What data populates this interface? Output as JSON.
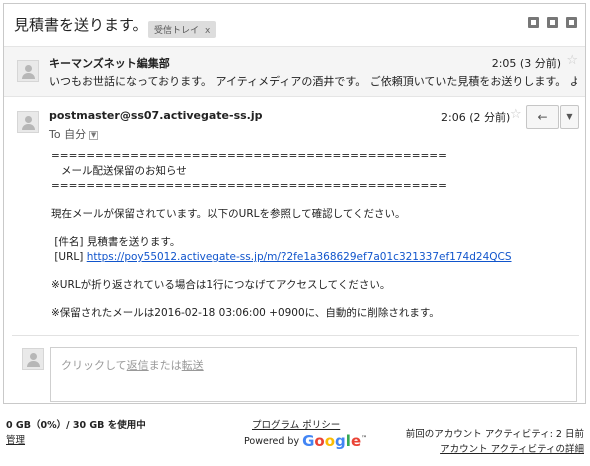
{
  "thread": {
    "subject": "見積書を送ります。",
    "label": "受信トレイ",
    "label_close": "x"
  },
  "messages": [
    {
      "sender": "キーマンズネット編集部",
      "time": "2:05 (3 分前)",
      "snippet": "いつもお世話になっております。 アイティメディアの酒井です。 ご依頼頂いていた見積をお送りします。 よ"
    },
    {
      "sender": "postmaster@ss07.activegate-ss.jp",
      "to": "To 自分",
      "time": "2:06 (2 分前)",
      "body": {
        "sep1": "=============================================",
        "heading": "   メール配送保留のお知らせ",
        "sep2": "=============================================",
        "p1": "現在メールが保留されています。以下のURLを参照して確認してください。",
        "subject_line": " [件名] 見積書を送ります。",
        "url_label": " [URL] ",
        "url": "https://poy55012.activegate-ss.jp/m/?2fe1a368629ef7a01c321337ef174d24QCS",
        "p2": "※URLが折り返されている場合は1行につなげてアクセスしてください。",
        "p3": "※保留されたメールは2016-02-18 03:06:00 +0900に、自動的に削除されます。"
      }
    }
  ],
  "reply": {
    "prefix": "クリックして",
    "reply_link": "返信",
    "middle": "または",
    "forward_link": "転送"
  },
  "footer": {
    "storage": "0 GB（0%）/ 30 GB を使用中",
    "manage": "管理",
    "policy": "プログラム ポリシー",
    "powered": "Powered by",
    "google": "Google",
    "last_activity": "前回のアカウント アクティビティ: 2 日前",
    "details": "アカウント アクティビティの詳細"
  },
  "icons": {
    "star": "☆",
    "reply_arrow": "←",
    "dropdown": "▼"
  },
  "colors": {
    "link": "#1155cc",
    "google_blue": "#4285f4",
    "google_red": "#ea4335",
    "google_yellow": "#fbbc05",
    "google_green": "#34a853"
  }
}
